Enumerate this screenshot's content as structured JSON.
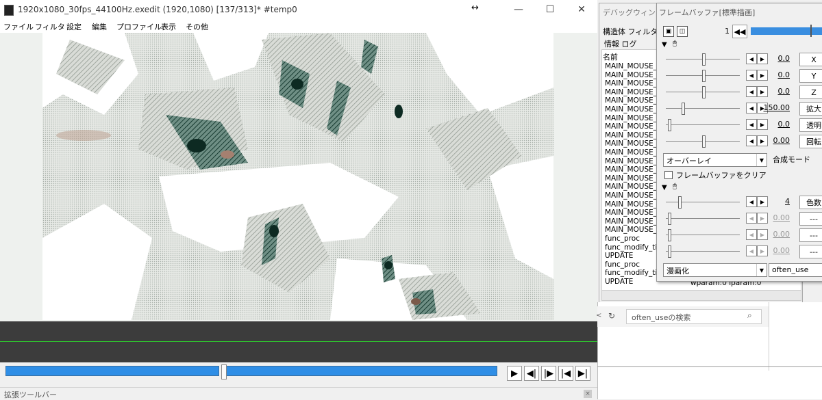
{
  "window": {
    "title": "1920x1080_30fps_44100Hz.exedit (1920,1080)  [137/313]* #temp0",
    "minimize": "—",
    "maximize": "☐",
    "close": "✕"
  },
  "menu": [
    "ファイル",
    "フィルタ",
    "設定",
    "編集",
    "プロファイル",
    "表示",
    "その他"
  ],
  "transport": {
    "buttons": [
      {
        "name": "play-button",
        "glyph": "▶"
      },
      {
        "name": "prev-frame-button",
        "glyph": "◀|"
      },
      {
        "name": "next-frame-button",
        "glyph": "|▶"
      },
      {
        "name": "jump-start-button",
        "glyph": "|◀"
      },
      {
        "name": "jump-end-button",
        "glyph": "▶|"
      }
    ]
  },
  "ext_toolbar": {
    "label": "拡張ツールバー"
  },
  "debug": {
    "title": "デバッグウィンドウ",
    "tabs_row1": "構造体  フィルタ",
    "tabs_row2": "情報   ログ",
    "list_header": "名前",
    "log_lines": [
      "MAIN_MOUSE_N",
      "MAIN_MOUSE_N",
      "MAIN_MOUSE_N",
      "MAIN_MOUSE_N",
      "MAIN_MOUSE_N",
      "MAIN_MOUSE_N",
      "MAIN_MOUSE_N",
      "MAIN_MOUSE_N",
      "MAIN_MOUSE_N",
      "MAIN_MOUSE_N",
      "MAIN_MOUSE_N",
      "MAIN_MOUSE_N",
      "MAIN_MOUSE_N",
      "MAIN_MOUSE_N",
      "MAIN_MOUSE_N",
      "MAIN_MOUSE_N",
      "MAIN_MOUSE_N",
      "MAIN_MOUSE_N",
      "MAIN_MOUSE_N",
      "MAIN_MOUSE_N",
      "func_proc",
      "func_modify_titl",
      "UPDATE",
      "func_proc",
      "func_modify_titl",
      "UPDATE"
    ],
    "last_param": "wparam:0 lparam:0"
  },
  "search": {
    "placeholder": "often_useの検索",
    "back": "<",
    "refresh": "↻",
    "icon": "search-icon"
  },
  "framebuffer": {
    "title": "フレームバッファ[標準描画]",
    "frame_number": "1",
    "rewind": "◀◀",
    "group1_params": [
      {
        "label": "X",
        "value": "0.0",
        "thumb": 0.5,
        "disabled": false
      },
      {
        "label": "Y",
        "value": "0.0",
        "thumb": 0.5,
        "disabled": false
      },
      {
        "label": "Z",
        "value": "0.0",
        "thumb": 0.5,
        "disabled": false
      },
      {
        "label": "拡大",
        "value": "150.00",
        "thumb": 0.2,
        "disabled": false
      },
      {
        "label": "透明",
        "value": "0.0",
        "thumb": 0.0,
        "disabled": false
      },
      {
        "label": "回転",
        "value": "0.00",
        "thumb": 0.5,
        "disabled": false
      }
    ],
    "blend_mode": "オーバーレイ",
    "blend_label": "合成モード",
    "clear_label": "フレームバッファをクリア",
    "group2_params": [
      {
        "label": "色数",
        "value": "4",
        "thumb": 0.15,
        "disabled": false
      },
      {
        "label": "---",
        "value": "0.00",
        "thumb": 0.0,
        "disabled": true
      },
      {
        "label": "---",
        "value": "0.00",
        "thumb": 0.0,
        "disabled": true
      },
      {
        "label": "---",
        "value": "0.00",
        "thumb": 0.0,
        "disabled": true
      }
    ],
    "effect": "漫画化",
    "preset": "often_use"
  }
}
